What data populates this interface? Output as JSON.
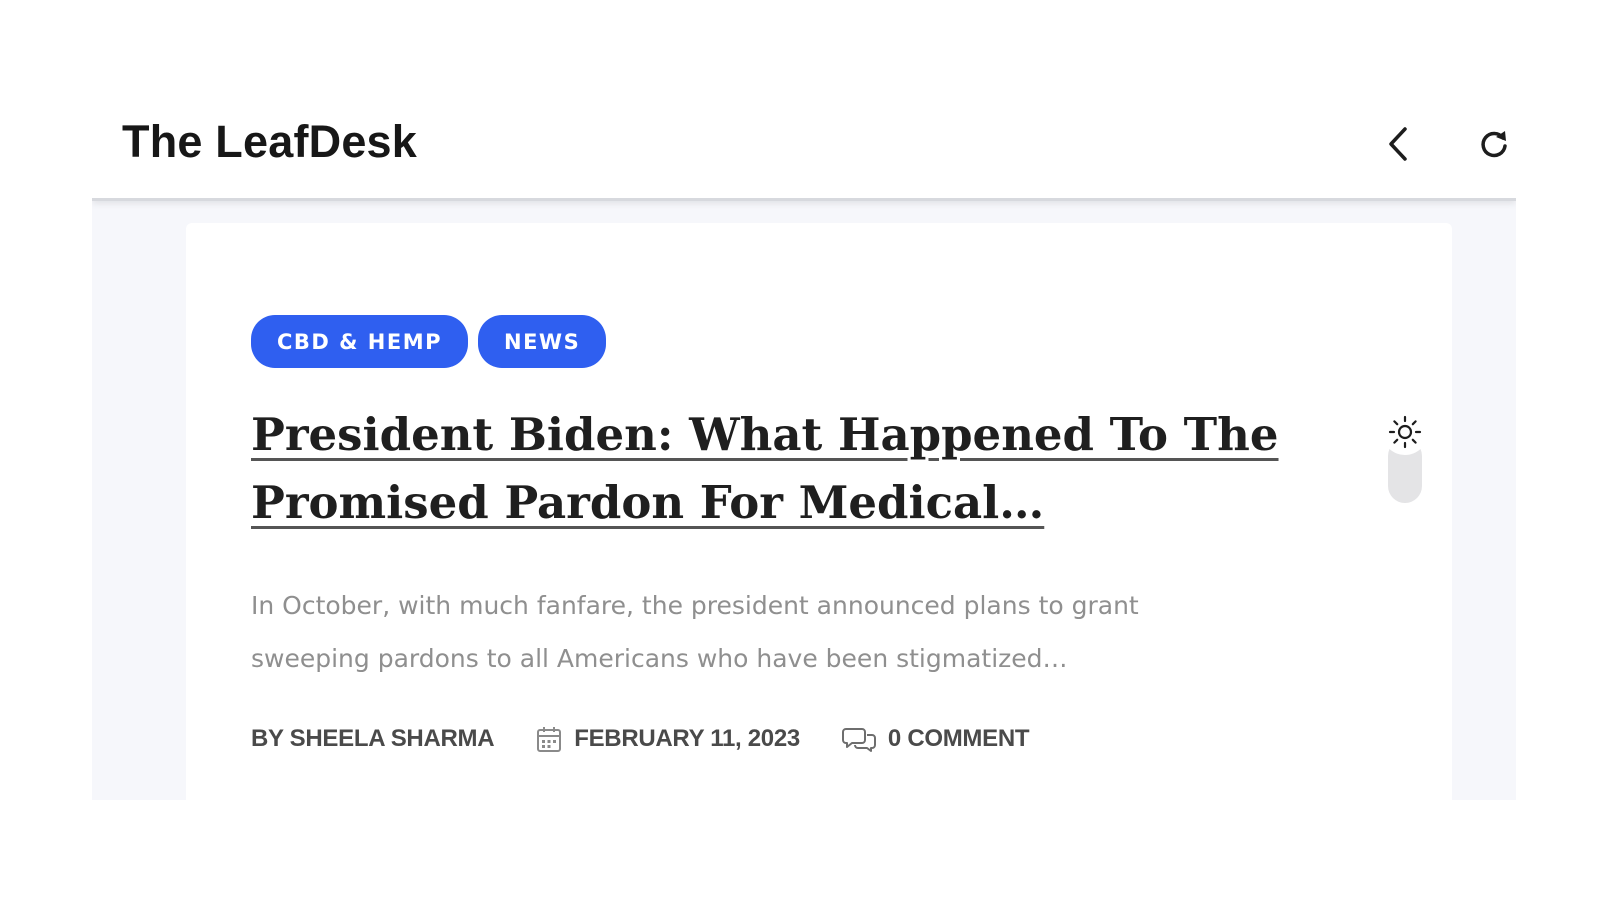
{
  "app": {
    "title": "The LeafDesk",
    "back_icon": "chevron-left-icon",
    "refresh_icon": "refresh-icon"
  },
  "article": {
    "tags": [
      "CBD & HEMP",
      "NEWS"
    ],
    "title_line1": "President Biden: What Happened To The",
    "title_line2": "Promised Pardon For Medical…",
    "excerpt_line1": "In October, with much fanfare, the president announced plans to grant",
    "excerpt_line2": "sweeping pardons to all Americans who have been stigmatized…",
    "author": "BY SHEELA SHARMA",
    "date": "FEBRUARY 11, 2023",
    "comments": "0 COMMENT",
    "date_icon": "calendar-icon",
    "comment_icon": "comment-bubbles-icon"
  },
  "theme_toggle": {
    "icon": "sun-icon"
  },
  "colors": {
    "tag_background": "#2f5ff0",
    "tag_text": "#ffffff",
    "headline": "#1f1f1f",
    "excerpt": "#8f8f8f",
    "meta": "#4a4a4a",
    "content_background": "#f6f7fb"
  }
}
